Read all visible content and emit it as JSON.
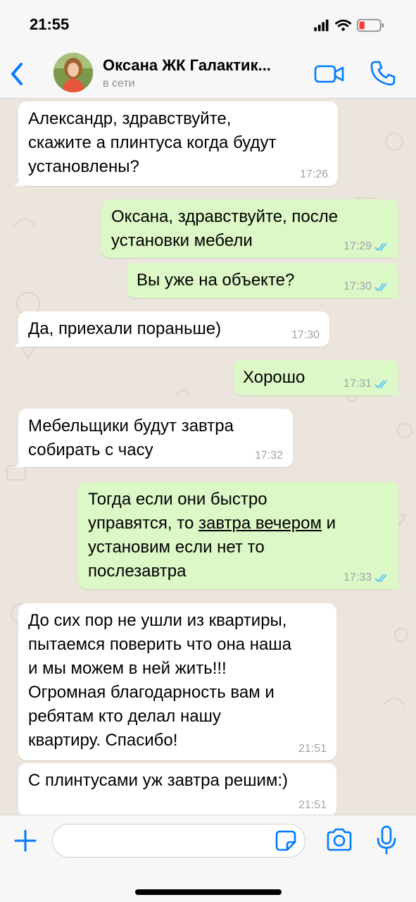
{
  "status_bar": {
    "time": "21:55"
  },
  "header": {
    "contact_name": "Оксана ЖК Галактик...",
    "contact_status": "в сети"
  },
  "messages": [
    {
      "direction": "in",
      "lines": [
        "Александр, здравствуйте,",
        "скажите а плинтуса когда будут",
        "установлены?"
      ],
      "time": "17:26"
    },
    {
      "direction": "out",
      "lines": [
        "Оксана, здравствуйте, после",
        "установки мебели"
      ],
      "time": "17:29",
      "read": true
    },
    {
      "direction": "out",
      "lines": [
        "Вы уже на объекте?"
      ],
      "time": "17:30",
      "read": true
    },
    {
      "direction": "in",
      "lines": [
        "Да, приехали пораньше)"
      ],
      "time": "17:30"
    },
    {
      "direction": "out",
      "lines": [
        "Хорошо"
      ],
      "time": "17:31",
      "read": true
    },
    {
      "direction": "in",
      "lines": [
        "Мебельщики будут завтра",
        "собирать с часу"
      ],
      "time": "17:32"
    },
    {
      "direction": "out",
      "line1": "Тогда если они быстро",
      "line2_prefix": "управятся, то ",
      "line2_link": "завтра вечером",
      "line2_suffix": " и",
      "line3": "установим если нет то",
      "line4": "послезавтра",
      "time": "17:33",
      "read": true
    },
    {
      "direction": "in",
      "lines": [
        "До сих пор не ушли из квартиры,",
        "пытаемся поверить что она наша",
        "и мы можем в ней жить!!!",
        "Огромная благодарность вам и",
        "ребятам кто делал нашу",
        "квартиру. Спасибо!"
      ],
      "time": "21:51"
    },
    {
      "direction": "in",
      "lines": [
        "С плинтусами уж завтра решим:)"
      ],
      "time": "21:51"
    }
  ],
  "input": {
    "value": "",
    "placeholder": ""
  },
  "colors": {
    "accent": "#007aff",
    "incoming_bubble": "#ffffff",
    "outgoing_bubble": "#dcf8c6",
    "read_ticks": "#4fc3f7",
    "chat_background": "#ece5dd"
  },
  "icons": {
    "back": "chevron-left-icon",
    "video": "video-camera-icon",
    "call": "phone-icon",
    "attach": "plus-icon",
    "sticker": "sticker-icon",
    "camera": "camera-icon",
    "mic": "microphone-icon"
  }
}
